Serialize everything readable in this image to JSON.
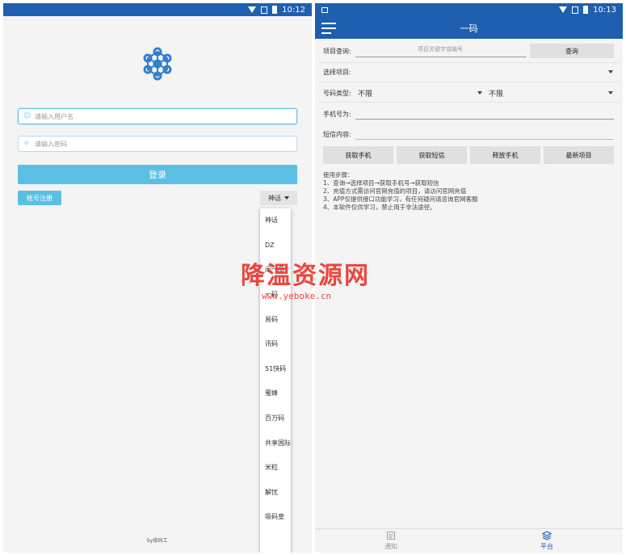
{
  "left": {
    "status": {
      "time": "10:12"
    },
    "username": {
      "placeholder": "请输入用户名"
    },
    "password": {
      "placeholder": "请输入密码"
    },
    "login_label": "登录",
    "register_label": "账号注册",
    "platform_selected": "神话",
    "platform_options": [
      "神话",
      "DZ",
      "闲一品",
      "一码",
      "易码",
      "讯码",
      "51快码",
      "蜜蜂",
      "百万码",
      "共享国际",
      "米粒",
      "解忧",
      "吸码皇"
    ],
    "credit": "by接码工"
  },
  "right": {
    "status": {
      "time": "10:13"
    },
    "title": "一码",
    "query_label": "项目查询:",
    "query_placeholder": "项目关键字或编号",
    "query_button": "查询",
    "select_project_label": "选择项目:",
    "number_type_label": "号码类型:",
    "number_type_value1": "不限",
    "number_type_value2": "不限",
    "phone_label": "手机号为:",
    "sms_label": "短信内容:",
    "actions": [
      "获取手机",
      "获取短信",
      "释放手机",
      "最新项目"
    ],
    "steps_title": "使用步骤：",
    "steps": [
      "1、查询→选择项目→获取手机号→获取短信",
      "2、充值方式需访问官网充值的项目，请访问官网充值",
      "3、APP仅提供接口功能学习，有任何疑问请咨询官网客服",
      "4、本软件仅供学习，禁止用于非法途径。"
    ],
    "nav": {
      "notice": "通知",
      "platform": "平台"
    },
    "accent": "#1e5fb0"
  },
  "watermark": {
    "title": "降温资源网",
    "url": "www.yeboke.cn"
  }
}
